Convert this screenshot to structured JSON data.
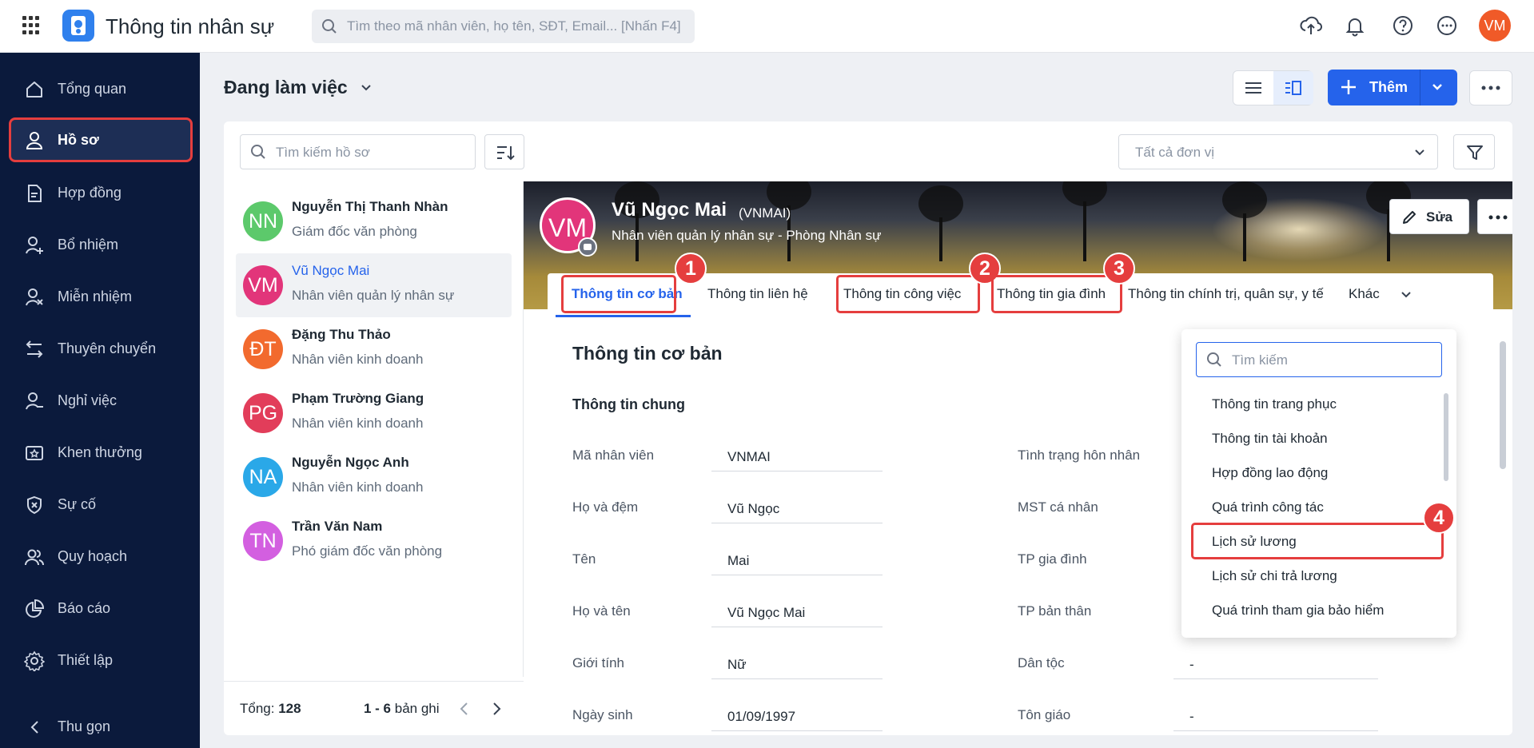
{
  "topbar": {
    "app_title": "Thông tin nhân sự",
    "search_placeholder": "Tìm theo mã nhân viên, họ tên, SĐT, Email... [Nhấn F4]",
    "user_initials": "VM"
  },
  "sidebar": {
    "items": [
      {
        "label": "Tổng quan",
        "icon": "home-icon"
      },
      {
        "label": "Hồ sơ",
        "icon": "user-icon"
      },
      {
        "label": "Hợp đồng",
        "icon": "document-icon"
      },
      {
        "label": "Bổ nhiệm",
        "icon": "user-plus-icon"
      },
      {
        "label": "Miễn nhiệm",
        "icon": "user-x-icon"
      },
      {
        "label": "Thuyên chuyển",
        "icon": "transfer-icon"
      },
      {
        "label": "Nghỉ việc",
        "icon": "user-minus-icon"
      },
      {
        "label": "Khen thưởng",
        "icon": "award-icon"
      },
      {
        "label": "Sự cố",
        "icon": "shield-icon"
      },
      {
        "label": "Quy hoạch",
        "icon": "users-icon"
      },
      {
        "label": "Báo cáo",
        "icon": "pie-chart-icon"
      },
      {
        "label": "Thiết lập",
        "icon": "gear-icon"
      }
    ],
    "collapse_label": "Thu gọn"
  },
  "main": {
    "status_filter": "Đang làm việc",
    "add_label": "Thêm",
    "list_search_placeholder": "Tìm kiếm hồ sơ",
    "unit_placeholder": "Tất cả đơn vị"
  },
  "employees": [
    {
      "initials": "NN",
      "name": "Nguyễn Thị Thanh Nhàn",
      "role": "Giám đốc văn phòng",
      "color": "#5cc96b"
    },
    {
      "initials": "VM",
      "name": "Vũ Ngọc Mai",
      "role": "Nhân viên quản lý nhân sự",
      "color": "#e2357a"
    },
    {
      "initials": "ĐT",
      "name": "Đặng Thu Thảo",
      "role": "Nhân viên kinh doanh",
      "color": "#f26a2e"
    },
    {
      "initials": "PG",
      "name": "Phạm Trường Giang",
      "role": "Nhân viên kinh doanh",
      "color": "#e23d5a"
    },
    {
      "initials": "NA",
      "name": "Nguyễn Ngọc Anh",
      "role": "Nhân viên kinh doanh",
      "color": "#2aa8e8"
    },
    {
      "initials": "TN",
      "name": "Trần Văn Nam",
      "role": "Phó giám đốc văn phòng",
      "color": "#d35fe0"
    }
  ],
  "list_footer": {
    "total_label": "Tổng:",
    "total_value": "128",
    "range": "1 - 6",
    "range_suffix": "bản ghi"
  },
  "profile": {
    "initials": "VM",
    "name": "Vũ Ngọc Mai",
    "code": "(VNMAI)",
    "role": "Nhân viên quản lý nhân sự - Phòng Nhân sự",
    "edit_label": "Sửa"
  },
  "tabs": [
    {
      "label": "Thông tin cơ bản"
    },
    {
      "label": "Thông tin liên hệ"
    },
    {
      "label": "Thông tin công việc"
    },
    {
      "label": "Thông tin gia đình"
    },
    {
      "label": "Thông tin chính trị, quân sự, y tế"
    },
    {
      "label": "Khác"
    }
  ],
  "badges": [
    "1",
    "2",
    "3",
    "4"
  ],
  "section": {
    "title": "Thông tin cơ bản",
    "subtitle": "Thông tin chung"
  },
  "fields_left": [
    {
      "label": "Mã nhân viên",
      "value": "VNMAI"
    },
    {
      "label": "Họ và đệm",
      "value": "Vũ Ngọc"
    },
    {
      "label": "Tên",
      "value": "Mai"
    },
    {
      "label": "Họ và tên",
      "value": "Vũ Ngọc Mai"
    },
    {
      "label": "Giới tính",
      "value": "Nữ"
    },
    {
      "label": "Ngày sinh",
      "value": "01/09/1997"
    }
  ],
  "fields_right": [
    {
      "label": "Tình trạng hôn nhân",
      "value": ""
    },
    {
      "label": "MST cá nhân",
      "value": ""
    },
    {
      "label": "TP gia đình",
      "value": ""
    },
    {
      "label": "TP bản thân",
      "value": ""
    },
    {
      "label": "Dân tộc",
      "value": "-"
    },
    {
      "label": "Tôn giáo",
      "value": "-"
    }
  ],
  "dropdown": {
    "search_placeholder": "Tìm kiếm",
    "items": [
      "Thông tin trang phục",
      "Thông tin tài khoản",
      "Hợp đồng lao động",
      "Quá trình công tác",
      "Lịch sử lương",
      "Lịch sử chi trả lương",
      "Quá trình tham gia bảo hiểm"
    ]
  }
}
